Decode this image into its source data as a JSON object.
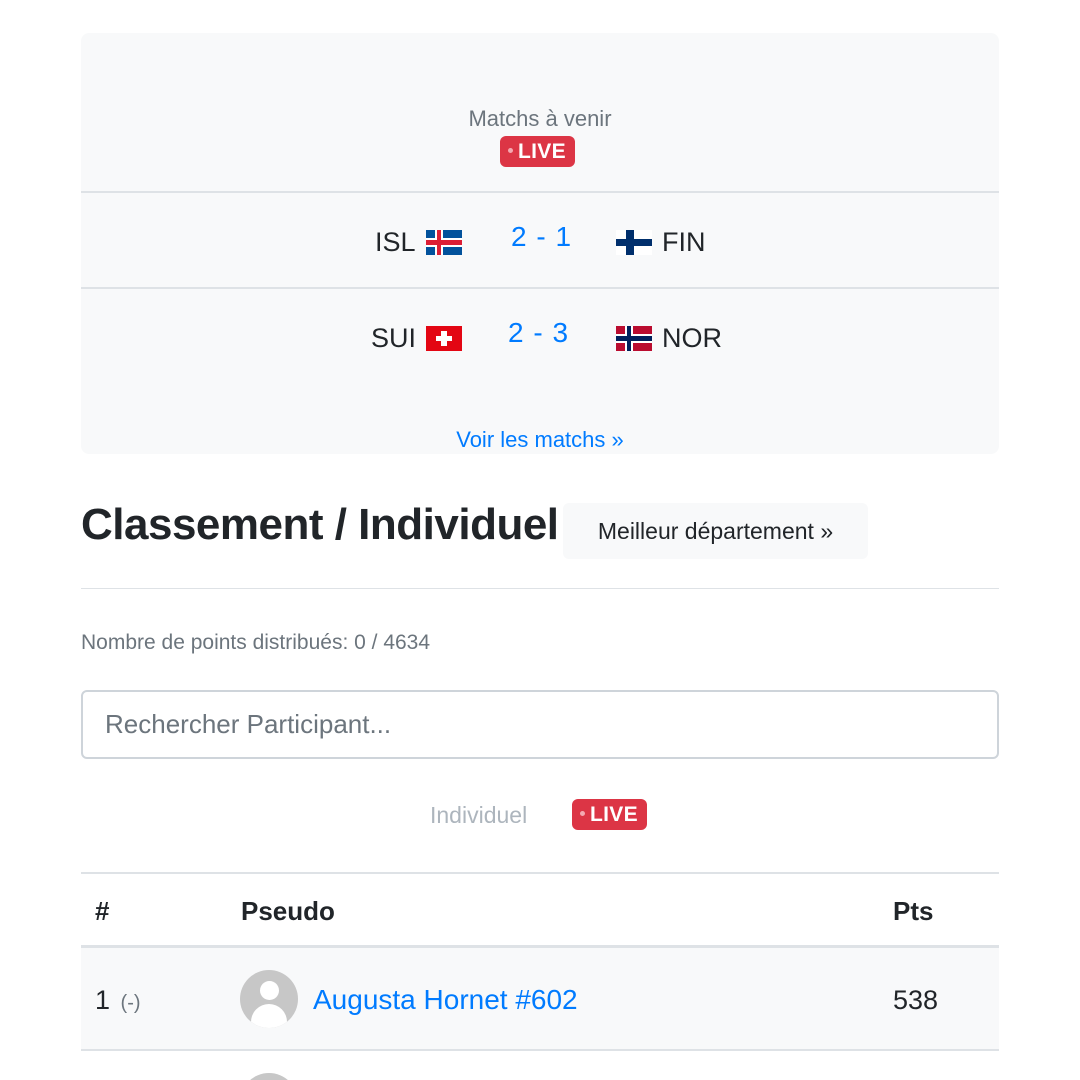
{
  "matches": {
    "title": "Matchs à venir",
    "live_label": "LIVE",
    "list": [
      {
        "home": "ISL",
        "home_flag": "iceland-flag-icon",
        "score": "2 - 1",
        "away": "FIN",
        "away_flag": "finland-flag-icon"
      },
      {
        "home": "SUI",
        "home_flag": "switzerland-flag-icon",
        "score": "2 - 3",
        "away": "NOR",
        "away_flag": "norway-flag-icon"
      }
    ],
    "see_all": "Voir les matchs »"
  },
  "ranking": {
    "title": "Classement / Individuel",
    "dept_button": "Meilleur département »",
    "points_text": "Nombre de points distribués: 0 / 4634",
    "search_placeholder": "Rechercher Participant...",
    "tab_label": "Individuel",
    "tab_live": "LIVE",
    "columns": {
      "rank": "#",
      "pseudo": "Pseudo",
      "pts": "Pts"
    },
    "rows": [
      {
        "rank": "1",
        "change": "(-)",
        "pseudo": "Augusta Hornet #602",
        "pts": "538",
        "avatar": "user-avatar-icon"
      }
    ]
  },
  "colors": {
    "link": "#007bff",
    "live": "#dc3545",
    "muted": "#6c757d",
    "card_bg": "#f8f9fa"
  }
}
